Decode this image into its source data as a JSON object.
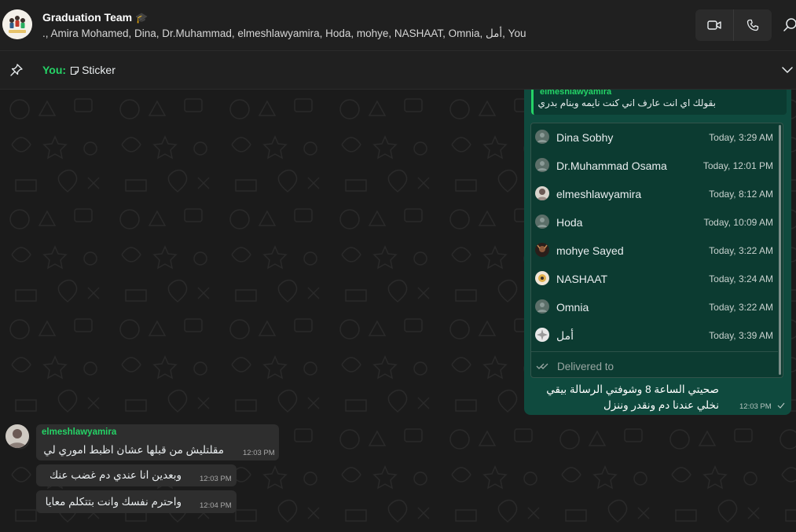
{
  "header": {
    "title": "Graduation Team",
    "title_emoji": "🎓",
    "members": "., Amira Mohamed, Dina, Dr.Muhammad, elmeshlawyamira, Hoda, mohye, NASHAAT, Omnia, أمل, You",
    "icons": [
      "group-avatar",
      "video-call-icon",
      "voice-call-icon",
      "search-icon"
    ]
  },
  "pinned": {
    "sender": "You:",
    "label": "Sticker"
  },
  "sent_message": {
    "quote_sender": "elmeshlawyamira",
    "quote_text": "بقولك اي انت عارف اني كنت نايمه وبنام بدري",
    "read_by": [
      {
        "name": "Dina Sobhy",
        "time": "Today, 3:29 AM"
      },
      {
        "name": "Dr.Muhammad Osama",
        "time": "Today, 12:01 PM"
      },
      {
        "name": "elmeshlawyamira",
        "time": "Today, 8:12 AM"
      },
      {
        "name": "Hoda",
        "time": "Today, 10:09 AM"
      },
      {
        "name": "mohye Sayed",
        "time": "Today, 3:22 AM"
      },
      {
        "name": "NASHAAT",
        "time": "Today, 3:24 AM"
      },
      {
        "name": "Omnia",
        "time": "Today, 3:22 AM"
      },
      {
        "name": "أمل",
        "time": "Today, 3:39 AM"
      }
    ],
    "delivered_label": "Delivered to",
    "text": "صحيتي الساعة 8 وشوفتي الرسالة بيقي نخلي عندنا دم ونقدر وننزل",
    "time": "12:03 PM",
    "status_icon": "check-icon"
  },
  "received": {
    "sender": "elmeshlawyamira",
    "messages": [
      {
        "text": "مقلتليش من قبلها عشان اظبط اموري لي",
        "time": "12:03 PM"
      },
      {
        "text": "وبعدين انا عندي دم غضب عنك",
        "time": "12:03 PM"
      },
      {
        "text": "واحترم نفسك وانت بتتكلم معايا",
        "time": "12:04 PM"
      }
    ]
  },
  "colors": {
    "accent": "#25d366",
    "sent_bubble": "#0f4a3e",
    "received_bubble": "#2e2e2e",
    "header_bg": "#202020",
    "chat_bg": "#1b1b1b"
  }
}
